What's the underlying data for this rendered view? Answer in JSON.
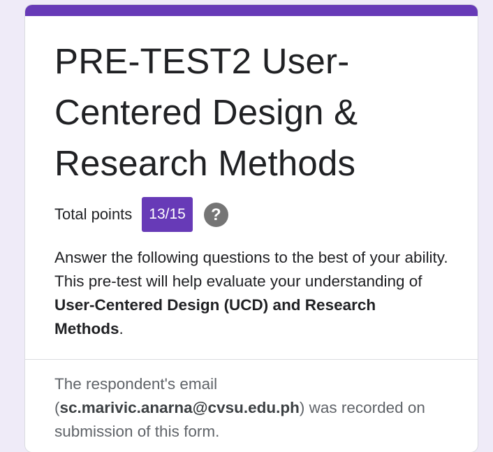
{
  "form": {
    "title": "PRE-TEST2 User-Centered Design & Research Methods",
    "points_label": "Total points",
    "points_value": "13/15",
    "help_glyph": "?",
    "description_lead": " Answer the following questions to the best of your ability. This pre-test will help evaluate your understanding of ",
    "description_bold": "User-Centered Design (UCD) and Research Methods",
    "description_end": ".",
    "email_prefix": "The respondent's email (",
    "email": "sc.marivic.anarna@cvsu.edu.ph",
    "email_suffix": ") was recorded on submission of this form."
  },
  "colors": {
    "accent": "#673ab7",
    "page_background": "#efebf8",
    "help_icon": "#757575"
  },
  "icons": {
    "help": "help-circle-icon"
  }
}
